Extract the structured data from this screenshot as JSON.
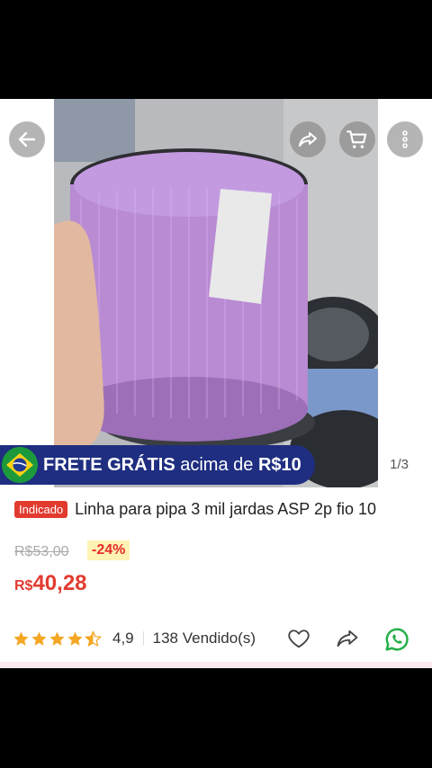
{
  "gallery": {
    "counter": "1/3",
    "icons": [
      "back-arrow-icon",
      "share-icon",
      "cart-icon",
      "more-icon"
    ]
  },
  "banner": {
    "free_shipping": "FRETE GRÁTIS",
    "above": "acima de",
    "amount": "R$10"
  },
  "product": {
    "badge": "Indicado",
    "title": "Linha para pipa 3 mil jardas ASP 2p fio 10",
    "old_price": "R$53,00",
    "discount": "-24%",
    "currency": "R$",
    "price": "40,28",
    "rating": "4,9",
    "rating_stars": 4.5,
    "sold": "138 Vendido(s)"
  },
  "colors": {
    "accent": "#e13b30",
    "banner_bg": "#1f2e80",
    "whatsapp": "#25b049",
    "star": "#f5a623"
  }
}
